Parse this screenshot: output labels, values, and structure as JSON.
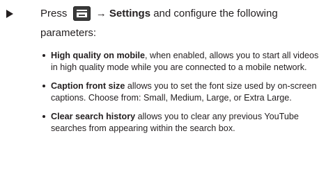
{
  "step": {
    "press_label": "Press",
    "menu_icon": "menu-key-icon",
    "arrow": "→",
    "settings_label": "Settings",
    "rest_text": "and configure the following",
    "continuation": "parameters:"
  },
  "bullets": [
    {
      "term": "High quality on mobile",
      "text": ", when enabled, allows you to start all videos in high quality mode while you are connected to a mobile network."
    },
    {
      "term": "Caption front size",
      "text": " allows you to set the font size used by on-screen captions. Choose from: Small, Medium, Large, or Extra Large."
    },
    {
      "term": "Clear search history",
      "text": " allows you to clear any previous YouTube searches from appearing within the search box."
    }
  ]
}
